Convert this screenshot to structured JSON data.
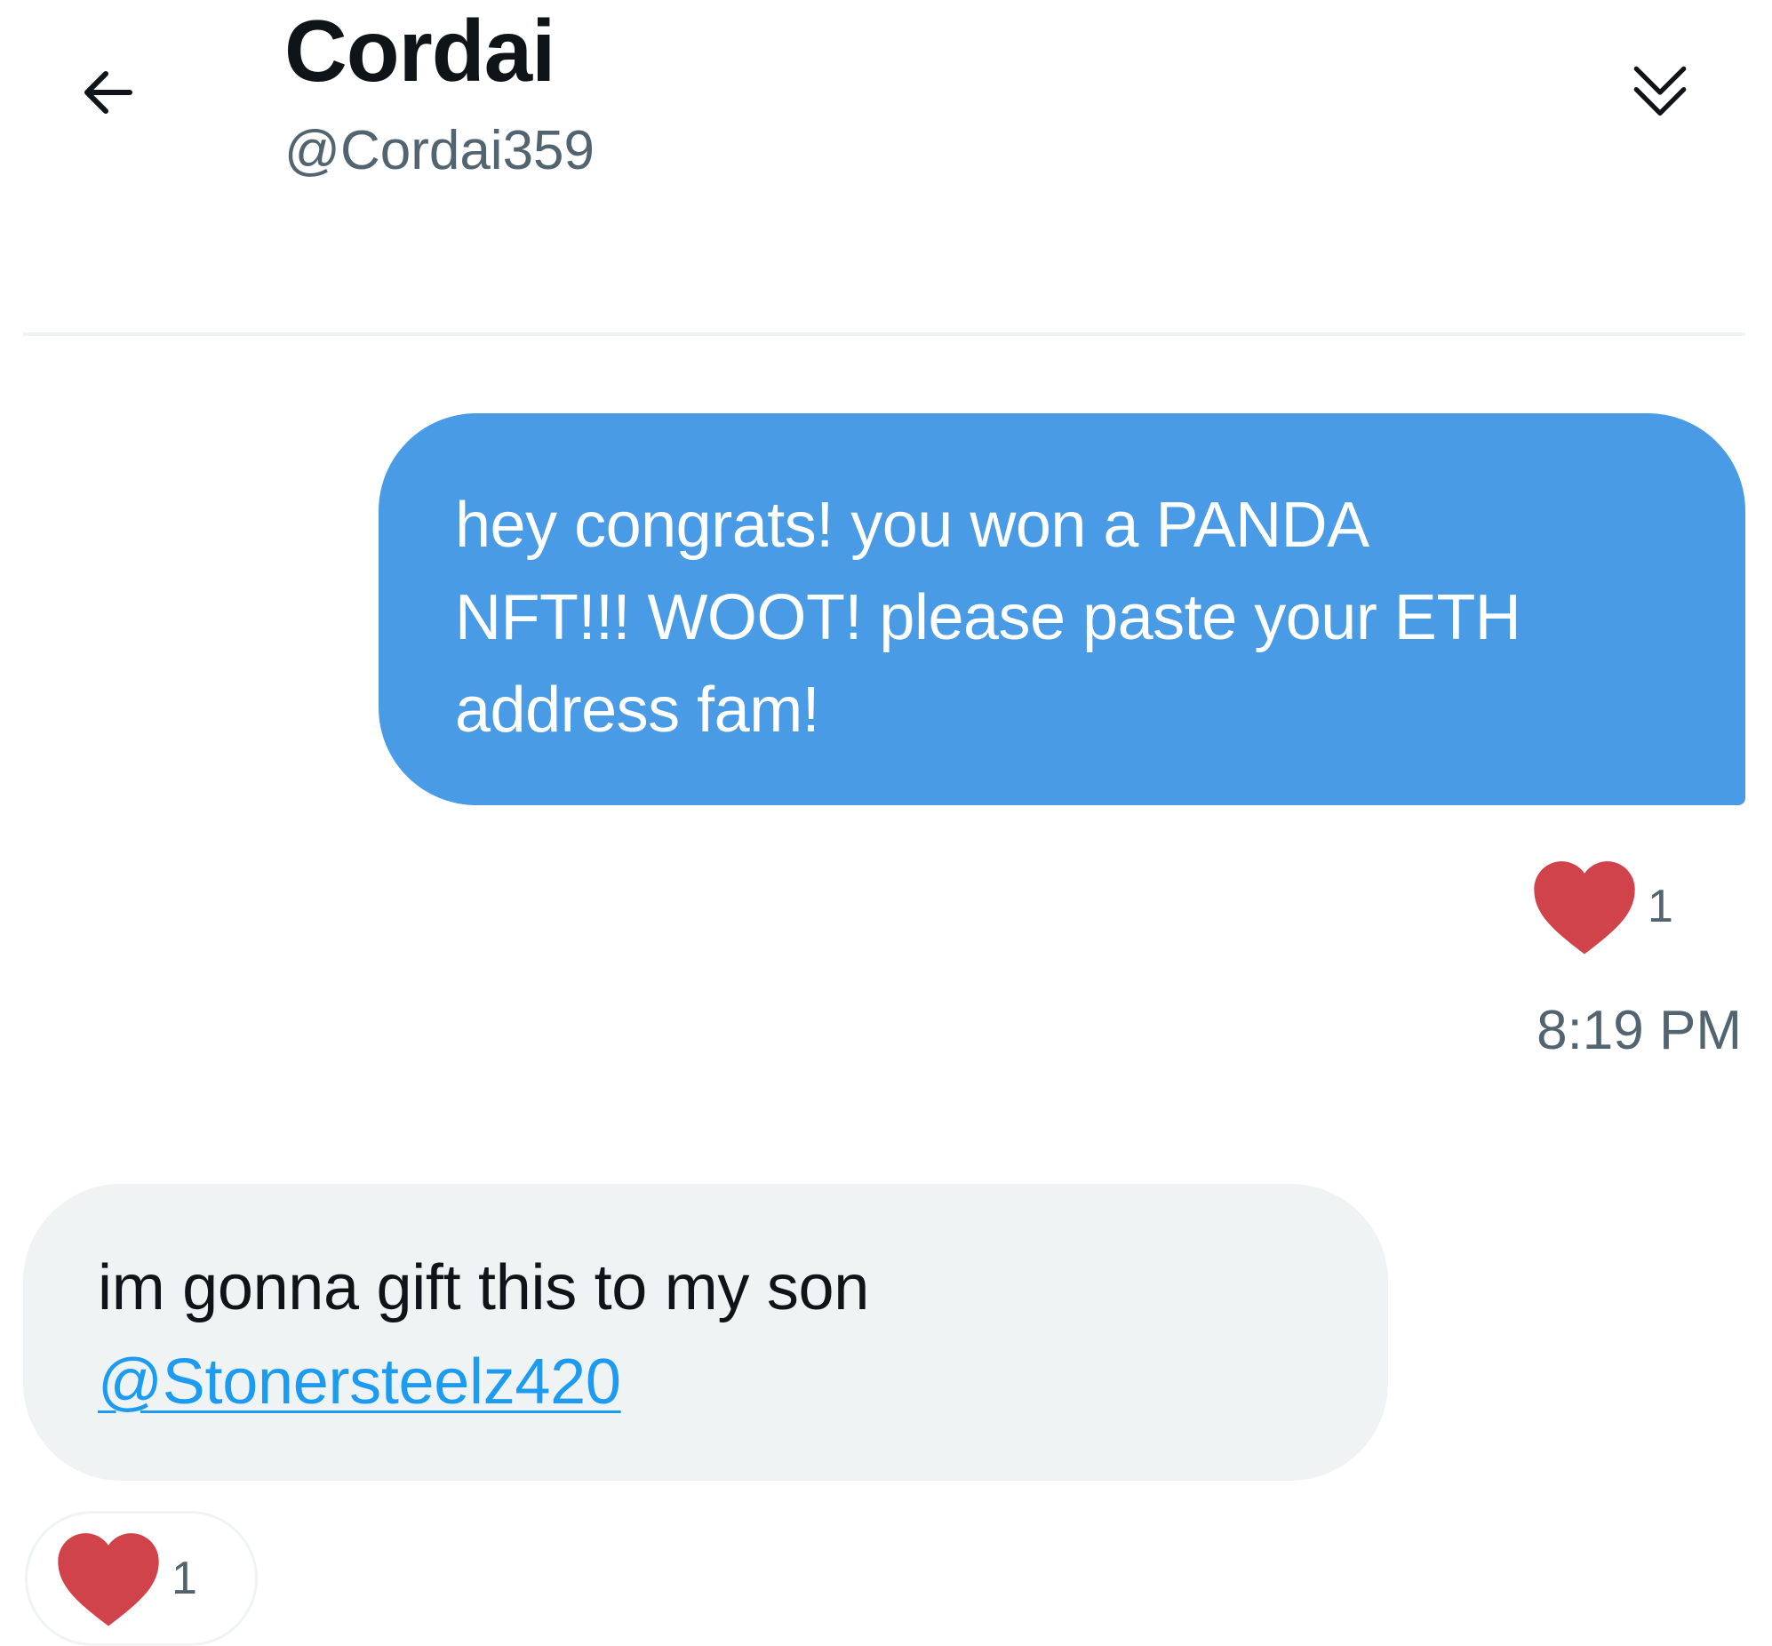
{
  "header": {
    "title": "Cordai",
    "handle": "@Cordai359",
    "back_icon": "arrow-left-icon",
    "collapse_icon": "double-chevron-down-icon"
  },
  "messages": [
    {
      "direction": "sent",
      "text_lines": [
        "hey congrats! you won a PANDA",
        "NFT!!! WOOT! please paste your ETH",
        "address fam!"
      ],
      "reaction": {
        "icon": "heart-icon",
        "count": "1"
      },
      "time": "8:19 PM"
    },
    {
      "direction": "received",
      "text": "im gonna gift this to my son",
      "mention": "@Stonersteelz420",
      "reaction": {
        "icon": "heart-icon",
        "count": "1"
      }
    }
  ],
  "colors": {
    "sent_bubble": "#4a9be6",
    "received_bubble": "#eff3f4",
    "heart": "#d0434a",
    "link": "#1d9bf0",
    "muted_text": "#536471"
  }
}
